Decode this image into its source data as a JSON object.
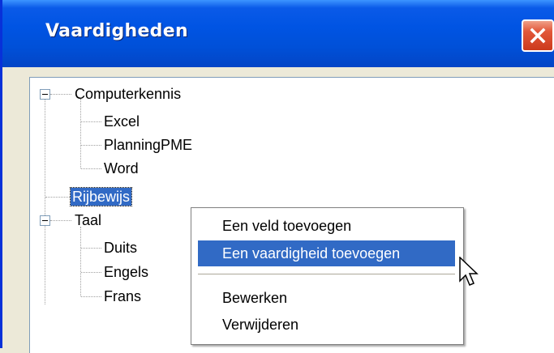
{
  "window": {
    "title": "Vaardigheden"
  },
  "tree": {
    "groups": [
      {
        "label": "Computerkennis",
        "expanded": true,
        "children": [
          "Excel",
          "PlanningPME",
          "Word"
        ]
      },
      {
        "label": "Rijbewijs",
        "selected": true
      },
      {
        "label": "Taal",
        "expanded": true,
        "children": [
          "Duits",
          "Engels",
          "Frans"
        ]
      }
    ]
  },
  "context_menu": {
    "items": [
      {
        "label": "Een veld toevoegen"
      },
      {
        "label": "Een vaardigheid toevoegen",
        "hovered": true
      },
      {
        "label": "Bewerken"
      },
      {
        "label": "Verwijderen"
      }
    ]
  },
  "colors": {
    "title_bar": "#0054e3",
    "selection": "#316ac5",
    "close_button": "#e2583a"
  },
  "icons": [
    "close-icon",
    "collapse-icon",
    "mouse-pointer-icon"
  ]
}
